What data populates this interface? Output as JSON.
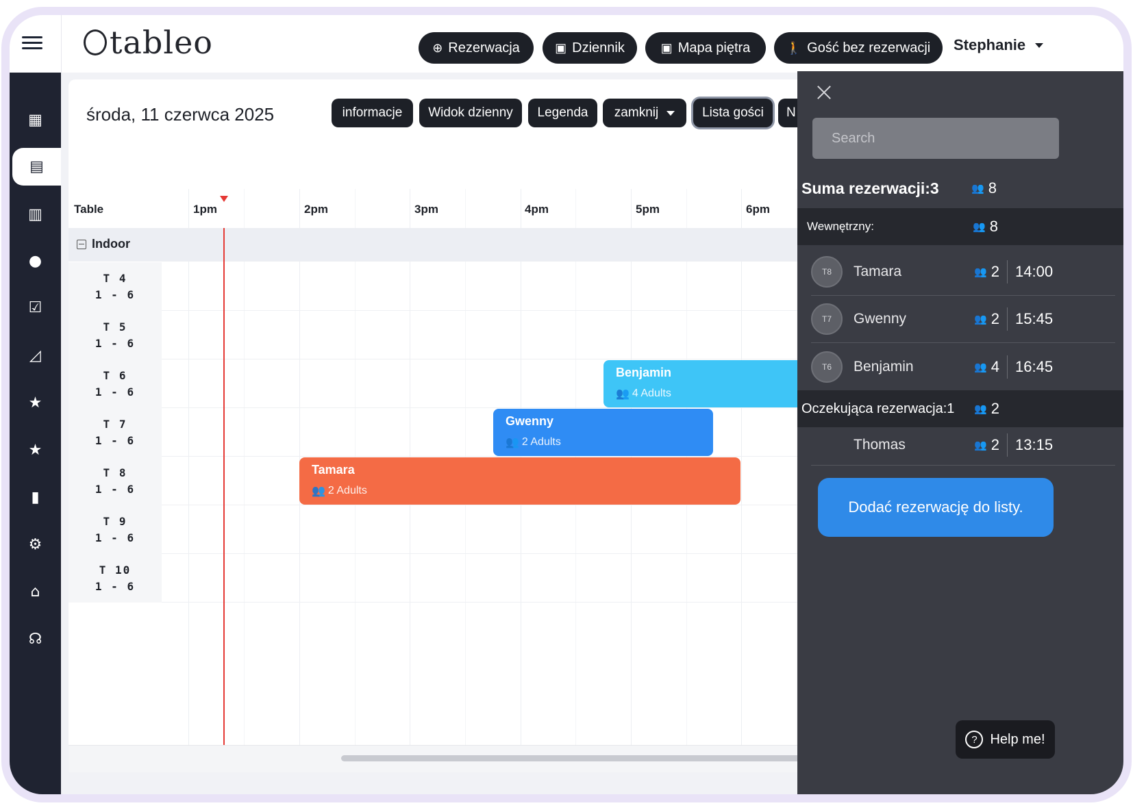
{
  "app": {
    "logo_text": "tableo"
  },
  "topbar": {
    "buttons": [
      {
        "label": "Rezerwacja",
        "icon": "plus-circle-icon"
      },
      {
        "label": "Dziennik",
        "icon": "calendar-icon"
      },
      {
        "label": "Mapa piętra",
        "icon": "calendar-icon"
      },
      {
        "label": "Gość bez rezerwacji",
        "icon": "walking-icon"
      }
    ],
    "user_name": "Stephanie"
  },
  "sidebar": {
    "items": [
      {
        "icon": "dashboard-icon"
      },
      {
        "icon": "calendar-icon",
        "active": true
      },
      {
        "icon": "book-icon"
      },
      {
        "icon": "user-icon"
      },
      {
        "icon": "check-message-icon"
      },
      {
        "icon": "chart-icon"
      },
      {
        "icon": "star-icon"
      },
      {
        "icon": "star-icon"
      },
      {
        "icon": "gift-card-icon"
      },
      {
        "icon": "gear-icon"
      },
      {
        "icon": "cake-icon"
      },
      {
        "icon": "headset-icon"
      }
    ]
  },
  "main": {
    "date": "środa, 11 czerwca 2025",
    "view_buttons": [
      {
        "label": "informacje"
      },
      {
        "label": "Widok dzienny"
      },
      {
        "label": "Legenda"
      },
      {
        "label": "zamknij"
      },
      {
        "label": "Lista gości"
      },
      {
        "label": "N"
      }
    ],
    "timeline": {
      "table_header": "Table",
      "hours": [
        "1pm",
        "2pm",
        "3pm",
        "4pm",
        "5pm",
        "6pm"
      ],
      "area": "Indoor",
      "tables": [
        {
          "name": "T 4",
          "capacity": "1 - 6"
        },
        {
          "name": "T 5",
          "capacity": "1 - 6"
        },
        {
          "name": "T 6",
          "capacity": "1 - 6"
        },
        {
          "name": "T 7",
          "capacity": "1 - 6"
        },
        {
          "name": "T 8",
          "capacity": "1 - 6"
        },
        {
          "name": "T 9",
          "capacity": "1 - 6"
        },
        {
          "name": "T 10",
          "capacity": "1 - 6"
        }
      ],
      "reservations": [
        {
          "name": "Benjamin",
          "guests": "4 Adults",
          "color": "#3ec5f7"
        },
        {
          "name": "Gwenny",
          "guests": "2 Adults",
          "color": "#2f8cf4"
        },
        {
          "name": "Tamara",
          "guests": "2 Adults",
          "color": "#f46b45"
        }
      ]
    }
  },
  "guest_panel": {
    "search_placeholder": "Search",
    "total_label": "Suma rezerwacji:3",
    "total_people": "8",
    "section_label": "Wewnętrzny:",
    "section_people": "8",
    "guests": [
      {
        "table": "T8",
        "name": "Tamara",
        "people": "2",
        "time": "14:00"
      },
      {
        "table": "T7",
        "name": "Gwenny",
        "people": "2",
        "time": "15:45"
      },
      {
        "table": "T6",
        "name": "Benjamin",
        "people": "4",
        "time": "16:45"
      }
    ],
    "pending_label": "Oczekująca rezerwacja:1",
    "pending_people": "2",
    "pending": [
      {
        "name": "Thomas",
        "people": "2",
        "time": "13:15"
      }
    ],
    "add_button": "Dodać rezerwację do listy.",
    "help_button": "Help me!"
  }
}
